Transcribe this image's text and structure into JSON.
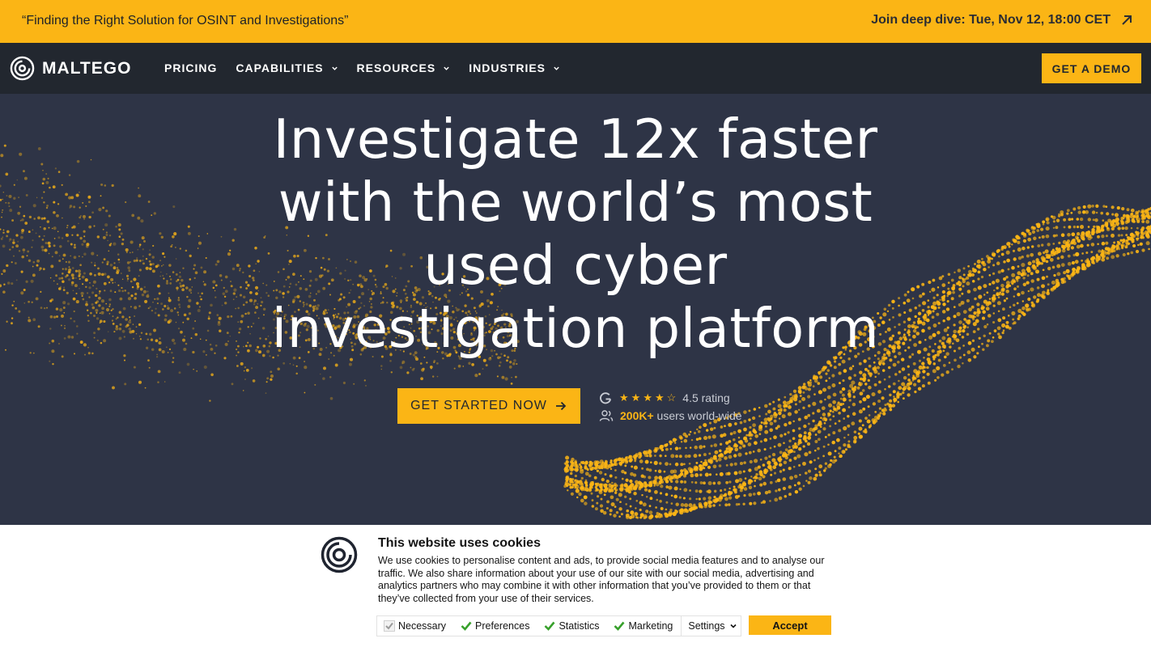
{
  "banner": {
    "quote": "“Finding the Right Solution for OSINT and Investigations”",
    "cta": "Join deep dive: Tue, Nov 12, 18:00 CET"
  },
  "nav": {
    "logo_text": "MALTEGO",
    "items": [
      {
        "label": "PRICING",
        "has_dropdown": false
      },
      {
        "label": "CAPABILITIES",
        "has_dropdown": true
      },
      {
        "label": "RESOURCES",
        "has_dropdown": true
      },
      {
        "label": "INDUSTRIES",
        "has_dropdown": true
      }
    ],
    "demo_label": "GET A DEMO"
  },
  "hero": {
    "headline_lines": [
      "Investigate 12x faster",
      "with the world’s most",
      "used cyber",
      "investigation platform"
    ],
    "cta_label": "GET STARTED NOW",
    "rating_stars": 4.5,
    "rating_text": "4.5 rating",
    "users_count": "200K+",
    "users_text": "users world-wide"
  },
  "cookie": {
    "title": "This website uses cookies",
    "text": "We use cookies to personalise content and ads, to provide social media features and to analyse our traffic. We also share information about your use of our site with our social media, advertising and analytics partners who may combine it with other information that you’ve provided to them or that they’ve collected from your use of their services.",
    "options": [
      {
        "label": "Necessary",
        "checked": true,
        "disabled": true
      },
      {
        "label": "Preferences",
        "checked": true,
        "disabled": false
      },
      {
        "label": "Statistics",
        "checked": true,
        "disabled": false
      },
      {
        "label": "Marketing",
        "checked": true,
        "disabled": false
      }
    ],
    "settings_label": "Settings",
    "accept_label": "Accept"
  },
  "colors": {
    "accent": "#fbb515",
    "navbar": "#22272f",
    "hero_bg": "#2e3446"
  }
}
